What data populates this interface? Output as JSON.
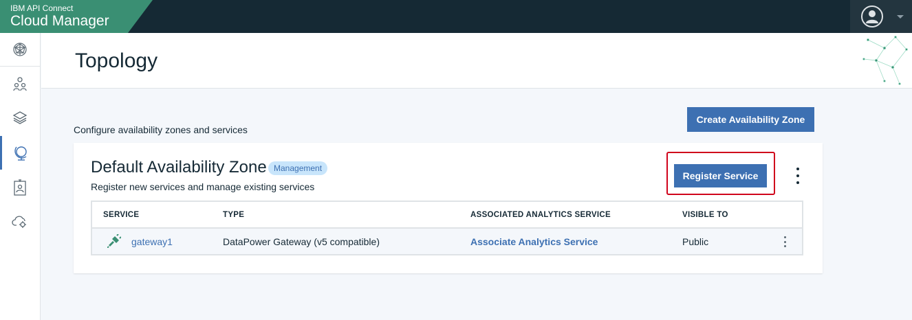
{
  "brand": {
    "subtitle": "IBM API Connect",
    "title": "Cloud Manager"
  },
  "user": {
    "avatar_icon": "user-avatar-icon",
    "menu_icon": "chevron-down-icon"
  },
  "sidebar": {
    "items": [
      {
        "name": "dashboard",
        "icon": "globe-network-icon"
      },
      {
        "name": "users",
        "icon": "users-icon"
      },
      {
        "name": "resources",
        "icon": "layers-icon"
      },
      {
        "name": "topology",
        "icon": "globe-stand-icon",
        "active": true
      },
      {
        "name": "member",
        "icon": "id-badge-icon"
      },
      {
        "name": "settings",
        "icon": "cloud-gear-icon"
      }
    ]
  },
  "page": {
    "title": "Topology",
    "intro": "Configure availability zones and services"
  },
  "actions": {
    "create_zone_label": "Create Availability Zone"
  },
  "zone": {
    "title": "Default Availability Zone",
    "badge": "Management",
    "subtitle": "Register new services and manage existing services",
    "register_label": "Register Service",
    "table": {
      "headers": [
        "SERVICE",
        "TYPE",
        "ASSOCIATED ANALYTICS SERVICE",
        "VISIBLE TO"
      ],
      "rows": [
        {
          "service": "gateway1",
          "service_icon": "gateway-plug-icon",
          "type": "DataPower Gateway (v5 compatible)",
          "analytics": "Associate Analytics Service",
          "visible_to": "Public"
        }
      ]
    }
  },
  "colors": {
    "accent": "#3d70b2",
    "brand": "#3a8f73",
    "topbar": "#152934",
    "highlight": "#d0021b"
  }
}
